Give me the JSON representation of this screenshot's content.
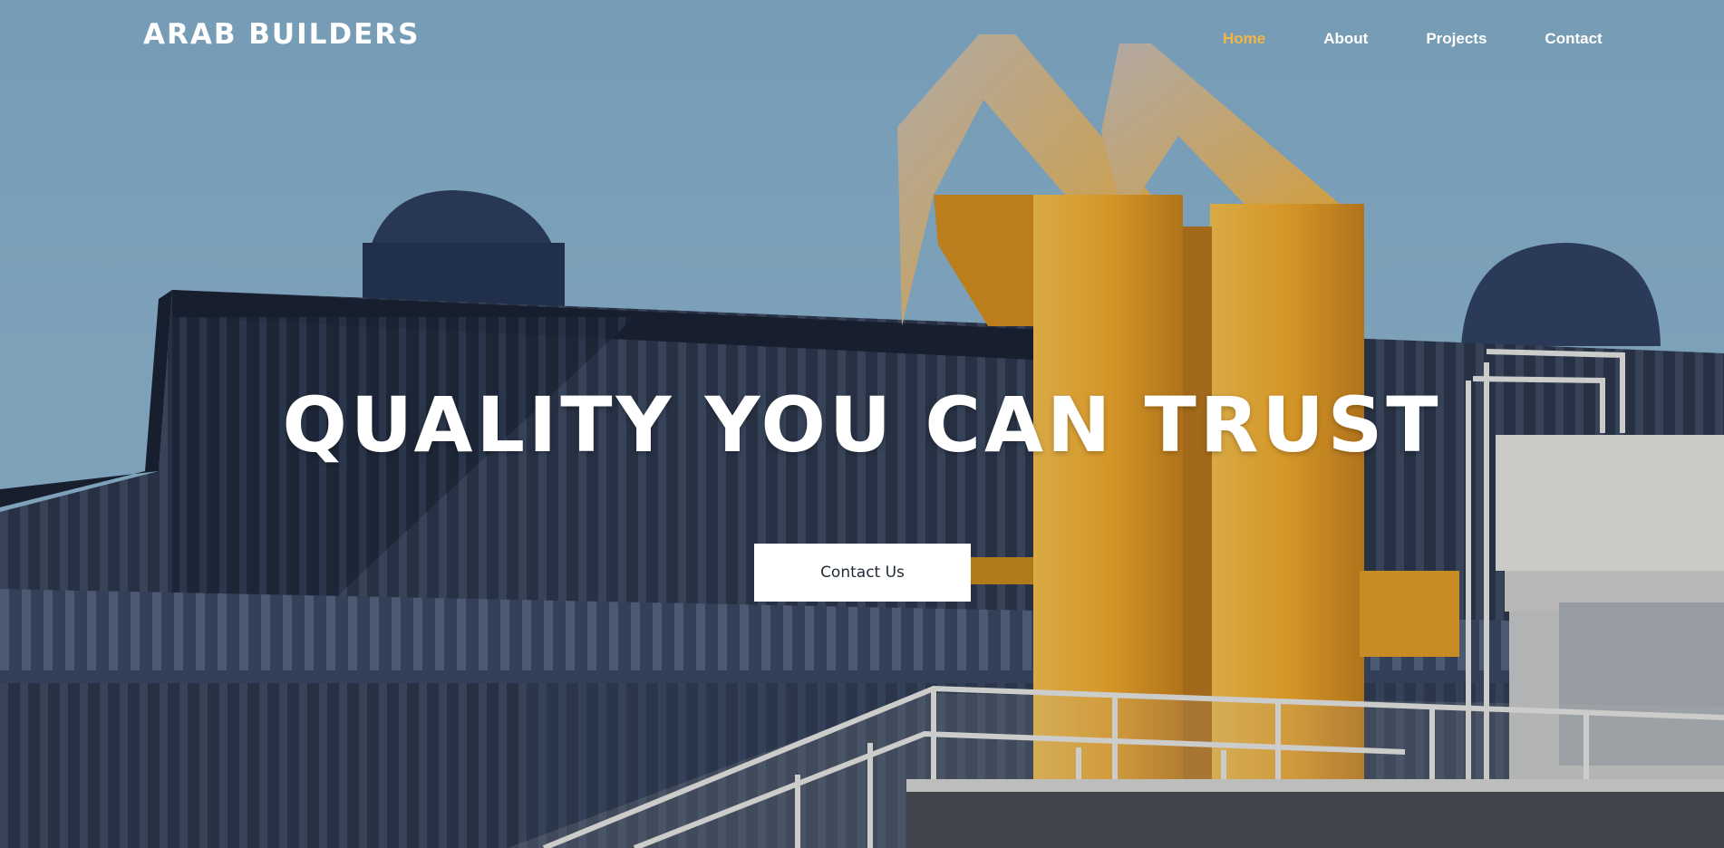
{
  "brand": {
    "name": "ARAB BUILDERS"
  },
  "nav": {
    "items": [
      {
        "label": "Home",
        "active": true
      },
      {
        "label": "About",
        "active": false
      },
      {
        "label": "Projects",
        "active": false
      },
      {
        "label": "Contact",
        "active": false
      }
    ]
  },
  "hero": {
    "headline": "QUALITY YOU CAN TRUST",
    "cta_label": "Contact Us",
    "image": "industrial-building-photo"
  },
  "colors": {
    "accent": "#f3b544",
    "sky": "#8ab3cd",
    "building": "#2b3547",
    "pipe": "#f0a82a",
    "text": "#ffffff",
    "button_text": "#1f2a36"
  }
}
